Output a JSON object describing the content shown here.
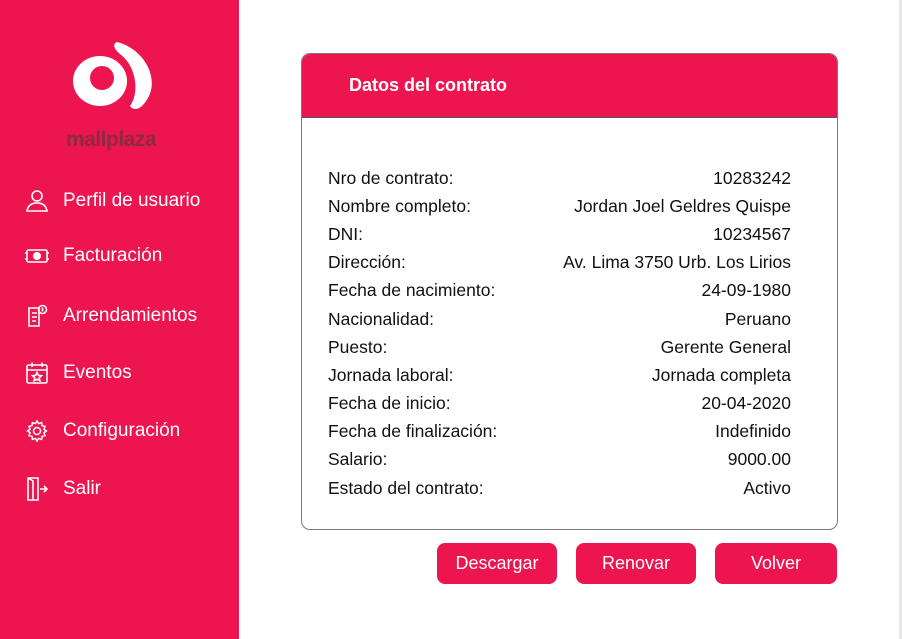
{
  "brand": {
    "name": "mallplaza",
    "accent": "#ec1550",
    "logo_text_color": "#8a2a43"
  },
  "sidebar": {
    "items": [
      {
        "label": "Perfil de usuario",
        "icon": "user-icon"
      },
      {
        "label": "Facturación",
        "icon": "money-icon"
      },
      {
        "label": "Arrendamientos",
        "icon": "document-icon"
      },
      {
        "label": "Eventos",
        "icon": "calendar-icon"
      },
      {
        "label": "Configuración",
        "icon": "gear-icon"
      },
      {
        "label": "Salir",
        "icon": "exit-icon"
      }
    ]
  },
  "card": {
    "title": "Datos del contrato",
    "rows": [
      {
        "label": "Nro de contrato:",
        "value": "10283242"
      },
      {
        "label": "Nombre completo:",
        "value": "Jordan Joel Geldres Quispe"
      },
      {
        "label": "DNI:",
        "value": "10234567"
      },
      {
        "label": "Dirección:",
        "value": "Av. Lima 3750 Urb. Los Lirios"
      },
      {
        "label": "Fecha de nacimiento:",
        "value": "24-09-1980"
      },
      {
        "label": "Nacionalidad:",
        "value": "Peruano"
      },
      {
        "label": "Puesto:",
        "value": "Gerente General"
      },
      {
        "label": "Jornada laboral:",
        "value": "Jornada completa"
      },
      {
        "label": "Fecha de inicio:",
        "value": "20-04-2020"
      },
      {
        "label": "Fecha de finalización:",
        "value": "Indefinido"
      },
      {
        "label": "Salario:",
        "value": "9000.00"
      },
      {
        "label": "Estado del contrato:",
        "value": "Activo"
      }
    ]
  },
  "actions": {
    "download_label": "Descargar",
    "renew_label": "Renovar",
    "back_label": "Volver"
  }
}
